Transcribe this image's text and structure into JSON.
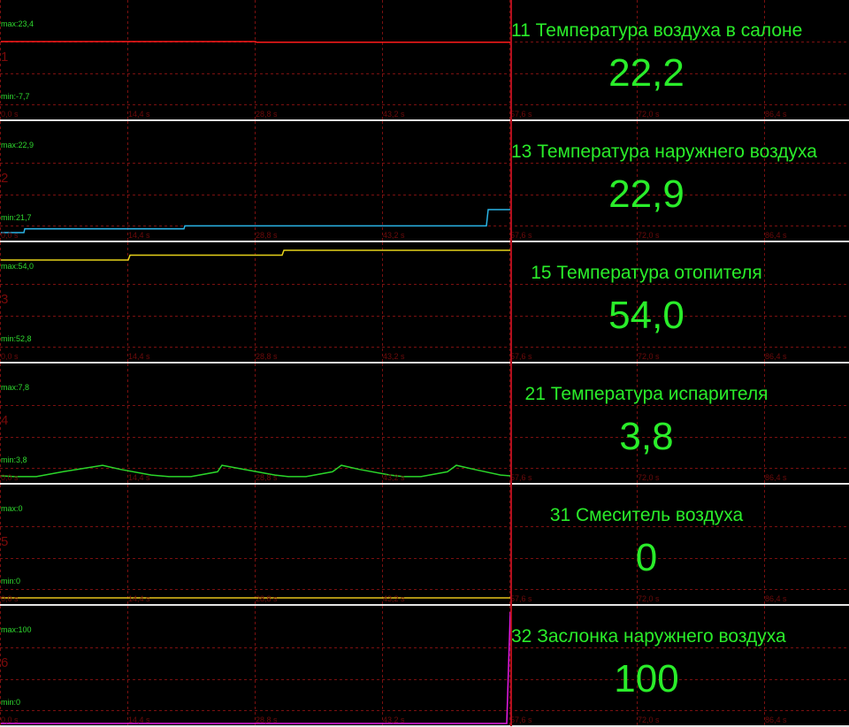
{
  "ticks": [
    "0,0 s",
    "14,4 s",
    "28,8 s",
    "43,2 s",
    "57,6 s",
    "72,0 s",
    "86,4 s"
  ],
  "channels": [
    {
      "num": "1",
      "title": "11 Температура воздуха в салоне",
      "value": "22,2",
      "max_label": "max:23,4",
      "min_label": "min:-7,7",
      "color": "#ff1a1a",
      "points": [
        [
          0,
          23.4
        ],
        [
          28.8,
          23.4
        ],
        [
          28.9,
          23.1
        ],
        [
          57.6,
          23.1
        ]
      ]
    },
    {
      "num": "2",
      "title": "13 Температура наружнего воздуха",
      "value": "22,9",
      "max_label": "max:22,9",
      "min_label": "min:21,7",
      "color": "#2ab4e6",
      "points": [
        [
          0,
          21.7
        ],
        [
          2.6,
          21.7
        ],
        [
          2.7,
          21.9
        ],
        [
          20.7,
          21.9
        ],
        [
          20.8,
          22.05
        ],
        [
          54.9,
          22.05
        ],
        [
          55.1,
          22.9
        ],
        [
          57.6,
          22.9
        ]
      ]
    },
    {
      "num": "3",
      "title": "15 Температура отопителя",
      "value": "54,0",
      "max_label": "max:54,0",
      "min_label": "min:52,8",
      "color": "#e6d21a",
      "points": [
        [
          0,
          52.8
        ],
        [
          14.4,
          52.8
        ],
        [
          14.6,
          53.4
        ],
        [
          31.8,
          53.4
        ],
        [
          32.0,
          54.0
        ],
        [
          57.6,
          54.0
        ]
      ]
    },
    {
      "num": "4",
      "title": "21 Температура испарителя",
      "value": "3,8",
      "max_label": "max:7,8",
      "min_label": "min:3,8",
      "color": "#2ad62a",
      "points": [
        [
          0,
          3.8
        ],
        [
          1.5,
          3.7
        ],
        [
          4.0,
          3.7
        ],
        [
          7.0,
          4.3
        ],
        [
          11.5,
          5.1
        ],
        [
          13.5,
          4.6
        ],
        [
          17.0,
          3.9
        ],
        [
          19.0,
          3.7
        ],
        [
          21.5,
          3.7
        ],
        [
          24.5,
          4.3
        ],
        [
          25.0,
          5.1
        ],
        [
          27.5,
          4.6
        ],
        [
          31.0,
          3.9
        ],
        [
          32.5,
          3.7
        ],
        [
          34.5,
          3.7
        ],
        [
          37.5,
          4.3
        ],
        [
          38.5,
          5.1
        ],
        [
          40.5,
          4.6
        ],
        [
          44.0,
          3.9
        ],
        [
          45.5,
          3.7
        ],
        [
          47.5,
          3.7
        ],
        [
          50.5,
          4.3
        ],
        [
          51.5,
          5.1
        ],
        [
          53.5,
          4.6
        ],
        [
          56.5,
          3.9
        ],
        [
          57.6,
          3.8
        ]
      ]
    },
    {
      "num": "5",
      "title": "31 Смеситель воздуха",
      "value": "0",
      "max_label": "max:0",
      "min_label": "min:0",
      "color": "#e6c21a",
      "points": [
        [
          0,
          0
        ],
        [
          57.6,
          0
        ]
      ]
    },
    {
      "num": "6",
      "title": "32 Заслонка наружнего воздуха",
      "value": "100",
      "max_label": "max:100",
      "min_label": "min:0",
      "color": "#e61ae6",
      "points": [
        [
          0,
          0
        ],
        [
          57.2,
          0
        ],
        [
          57.6,
          100
        ]
      ]
    }
  ]
}
